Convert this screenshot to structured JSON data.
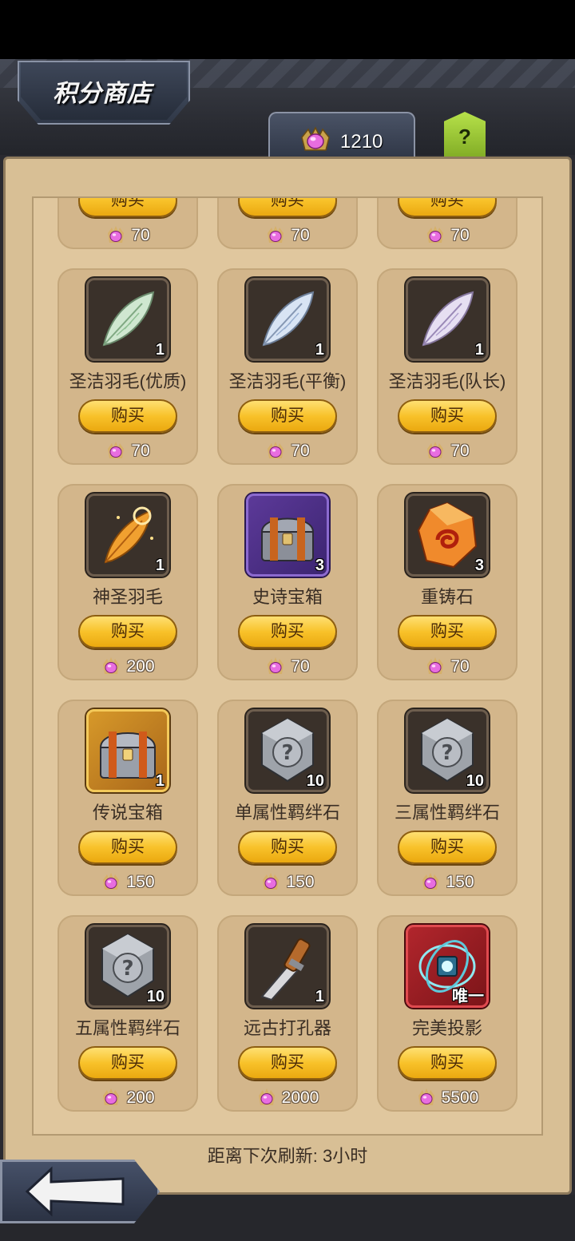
{
  "header": {
    "title": "积分商店",
    "currency_value": "1210",
    "help_label": "?"
  },
  "colors": {
    "gem": "#e86de0",
    "button_gold": "#f8c22a",
    "card_bg": "#d3b68b",
    "panel_bg": "#e0c79e"
  },
  "partial_row": {
    "buy_label": "购买",
    "prices": [
      "70",
      "70",
      "70"
    ]
  },
  "items": [
    {
      "name": "圣洁羽毛(优质)",
      "qty": "1",
      "buy": "购买",
      "price": "70",
      "icon": "green-feather-icon"
    },
    {
      "name": "圣洁羽毛(平衡)",
      "qty": "1",
      "buy": "购买",
      "price": "70",
      "icon": "blue-feather-icon"
    },
    {
      "name": "圣洁羽毛(队长)",
      "qty": "1",
      "buy": "购买",
      "price": "70",
      "icon": "purple-feather-icon"
    },
    {
      "name": "神圣羽毛",
      "qty": "1",
      "buy": "购买",
      "price": "200",
      "icon": "holy-feather-icon"
    },
    {
      "name": "史诗宝箱",
      "qty": "3",
      "buy": "购买",
      "price": "70",
      "icon": "epic-chest-icon"
    },
    {
      "name": "重铸石",
      "qty": "3",
      "buy": "购买",
      "price": "70",
      "icon": "reforge-stone-icon"
    },
    {
      "name": "传说宝箱",
      "qty": "1",
      "buy": "购买",
      "price": "150",
      "icon": "legendary-chest-icon"
    },
    {
      "name": "单属性羁绊石",
      "qty": "10",
      "buy": "购买",
      "price": "150",
      "icon": "mystery-stone-icon"
    },
    {
      "name": "三属性羁绊石",
      "qty": "10",
      "buy": "购买",
      "price": "150",
      "icon": "mystery-stone-icon"
    },
    {
      "name": "五属性羁绊石",
      "qty": "10",
      "buy": "购买",
      "price": "200",
      "icon": "mystery-stone-icon"
    },
    {
      "name": "远古打孔器",
      "qty": "1",
      "buy": "购买",
      "price": "2000",
      "icon": "chisel-icon"
    },
    {
      "name": "完美投影",
      "qty": "唯一",
      "buy": "购买",
      "price": "5500",
      "icon": "projector-icon"
    }
  ],
  "footer": {
    "refresh_text": "距离下次刷新: 3小时"
  }
}
